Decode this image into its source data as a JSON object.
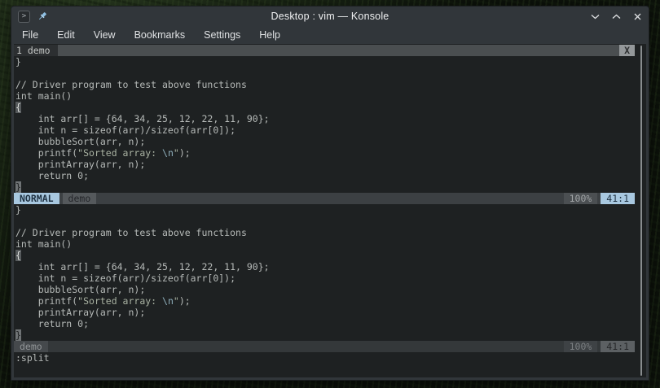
{
  "window": {
    "title": "Desktop : vim — Konsole",
    "app_icon_glyph": ">",
    "controls": {
      "minimize": "chevron-down",
      "maximize": "chevron-up",
      "close": "x"
    }
  },
  "menu": {
    "items": [
      "File",
      "Edit",
      "View",
      "Bookmarks",
      "Settings",
      "Help"
    ]
  },
  "terminal": {
    "tabline": {
      "current_tab": "1 demo",
      "close_label": "X"
    },
    "buffer_lines": [
      [
        {
          "t": "}",
          "s": "plain"
        }
      ],
      [],
      [
        {
          "t": "// Driver program to test above functions",
          "s": "plain"
        }
      ],
      [
        {
          "t": "int main()",
          "s": "plain"
        }
      ],
      [
        {
          "t": "{",
          "s": "match"
        }
      ],
      [
        {
          "t": "    int arr[] = {64, 34, 25, 12, 22, 11, 90};",
          "s": "plain"
        }
      ],
      [
        {
          "t": "    int n = sizeof(arr)/sizeof(arr[0]);",
          "s": "plain"
        }
      ],
      [
        {
          "t": "    bubbleSort(arr, n);",
          "s": "plain"
        }
      ],
      [
        {
          "t": "    printf(",
          "s": "plain"
        },
        {
          "t": "\"Sorted array: ",
          "s": "string"
        },
        {
          "t": "\\n",
          "s": "escape"
        },
        {
          "t": "\"",
          "s": "string"
        },
        {
          "t": ");",
          "s": "plain"
        }
      ],
      [
        {
          "t": "    printArray(arr, n);",
          "s": "plain"
        }
      ],
      [
        {
          "t": "    return 0;",
          "s": "plain"
        }
      ],
      [
        {
          "t": "}",
          "s": "cursor"
        }
      ]
    ],
    "panes": [
      {
        "status": {
          "mode": "NORMAL",
          "file": "demo",
          "percent": "100%",
          "position": "41:1"
        }
      },
      {
        "status": {
          "file": "demo",
          "percent": "100%",
          "position": "41:1"
        }
      }
    ],
    "command_line": ":split"
  },
  "colors": {
    "accent_blue": "#a8c8e0",
    "titlebar_bg": "#31363a",
    "terminal_bg": "#1e2122",
    "statusline_bg": "#3c4043",
    "tabline_fill": "#4a4e50",
    "desktop_green": "#1c2a16"
  }
}
